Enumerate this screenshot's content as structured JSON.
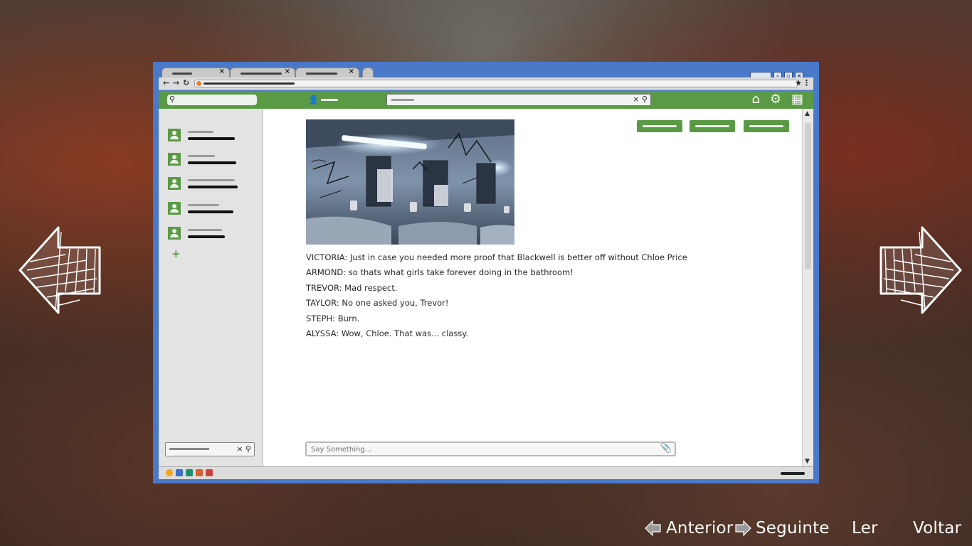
{
  "colors": {
    "window_frame": "#4a79c9",
    "accent_green": "#5a9a45",
    "sidebar": "#e3e3e3",
    "text": "#2a2a2a"
  },
  "browser": {
    "tabs": [
      {
        "icon": "close-icon"
      },
      {
        "icon": "close-icon"
      },
      {
        "icon": "close-icon"
      }
    ],
    "toolbar_icons": [
      "back-arrow-icon",
      "forward-arrow-icon",
      "reload-icon",
      "star-icon",
      "menu-icon"
    ],
    "top_icons": [
      "home-icon",
      "gear-icon",
      "apps-grid-icon"
    ]
  },
  "sidebar": {
    "contacts_count": 5
  },
  "feed": {
    "image_alt": "Photo of a graffiti-covered school bathroom",
    "messages": [
      {
        "speaker": "VICTORIA",
        "text": "VICTORIA: Just in case you needed more proof that Blackwell is better off without Chloe Price"
      },
      {
        "speaker": "ARMOND",
        "text": "ARMOND: so thats what girls take forever doing in the bathroom!"
      },
      {
        "speaker": "TREVOR",
        "text": "TREVOR: Mad respect."
      },
      {
        "speaker": "TAYLOR",
        "text": "TAYLOR: No one asked you, Trevor!"
      },
      {
        "speaker": "STEPH",
        "text": "STEPH: Burn."
      },
      {
        "speaker": "ALYSSA",
        "text": "ALYSSA: Wow, Chloe. That was... classy."
      }
    ],
    "chat_placeholder": "Say Something..."
  },
  "hints": {
    "previous": "Anterior",
    "next": "Seguinte",
    "read": "Ler",
    "back": "Voltar"
  }
}
